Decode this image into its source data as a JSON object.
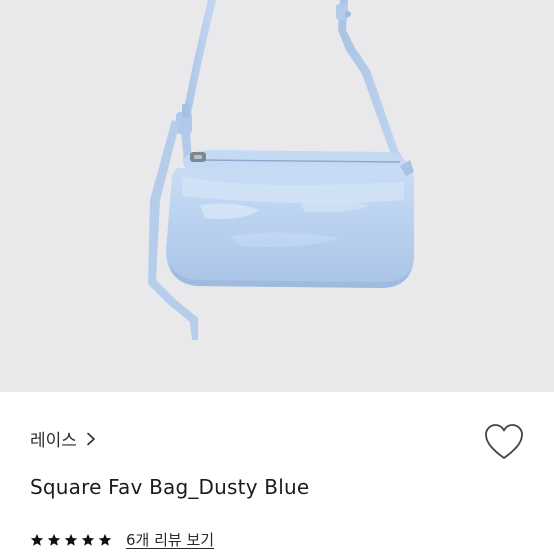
{
  "product": {
    "brand": "레이스",
    "name": "Square Fav Bag_Dusty Blue",
    "rating": 5,
    "rating_max": 5,
    "review_link": "6개 리뷰 보기",
    "image_alt_icon": "bag-photo",
    "wishlist_icon": "heart-outline-icon"
  },
  "colors": {
    "bag_blue": "#bcd4f0",
    "image_bg": "#e9e9eb",
    "star": "#111111"
  }
}
